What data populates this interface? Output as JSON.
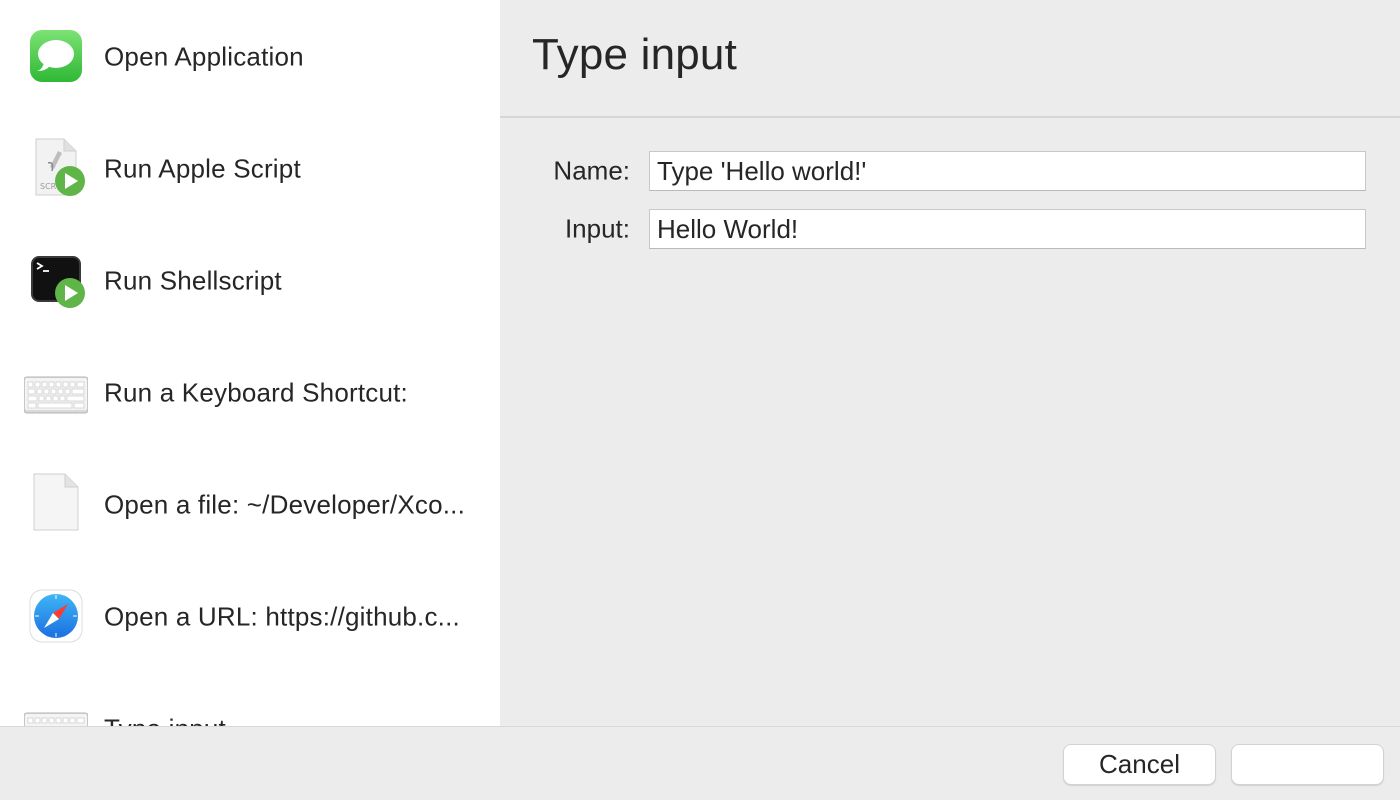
{
  "sidebar": {
    "items": [
      {
        "label": "Open Application",
        "icon": "messages-app-icon"
      },
      {
        "label": "Run Apple Script",
        "icon": "applescript-icon"
      },
      {
        "label": "Run Shellscript",
        "icon": "terminal-icon"
      },
      {
        "label": "Run a Keyboard Shortcut:",
        "icon": "keyboard-icon"
      },
      {
        "label": "Open a file: ~/Developer/Xco...",
        "icon": "document-icon"
      },
      {
        "label": "Open a URL: https://github.c...",
        "icon": "safari-icon"
      },
      {
        "label": "Type input",
        "icon": "keyboard-icon"
      }
    ]
  },
  "detail": {
    "title": "Type input",
    "fields": {
      "name_label": "Name:",
      "name_value": "Type 'Hello world!'",
      "input_label": "Input:",
      "input_value": "Hello World!"
    }
  },
  "footer": {
    "cancel_label": "Cancel",
    "primary_label": ""
  },
  "colors": {
    "sidebar_bg": "#ffffff",
    "panel_bg": "#ececec",
    "text": "#262626",
    "messages_green": "#4cd964",
    "play_green": "#5fb548"
  }
}
